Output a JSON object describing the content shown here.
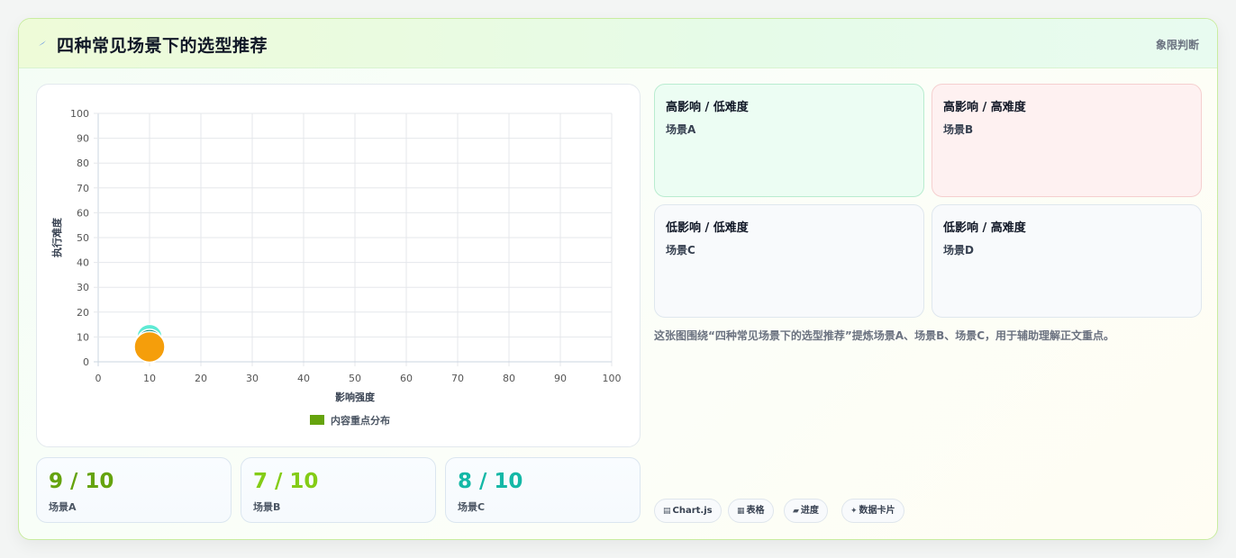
{
  "header": {
    "title": "四种常见场景下的选型推荐",
    "tag": "象限判断"
  },
  "chart_data": {
    "type": "scatter",
    "x_axis": {
      "label": "影响强度",
      "min": 0,
      "max": 100,
      "ticks": [
        0,
        10,
        20,
        30,
        40,
        50,
        60,
        70,
        80,
        90,
        100
      ]
    },
    "y_axis": {
      "label": "执行难度",
      "min": 0,
      "max": 100,
      "ticks": [
        0,
        10,
        20,
        30,
        40,
        50,
        60,
        70,
        80,
        90,
        100
      ]
    },
    "grid": true,
    "legend": {
      "position": "bottom",
      "label": "内容重点分布",
      "color": "#65a30d"
    },
    "points": [
      {
        "x": 10,
        "y": 10,
        "color": "#5eead4",
        "size": "medium"
      },
      {
        "x": 10,
        "y": 8,
        "color": "#0d9488",
        "size": "medium"
      },
      {
        "x": 10,
        "y": 6,
        "color": "#f59e0b",
        "size": "large"
      }
    ]
  },
  "stats": [
    {
      "value": "9 / 10",
      "label": "场景A",
      "color": "#65a30d"
    },
    {
      "value": "7 / 10",
      "label": "场景B",
      "color": "#84cc16"
    },
    {
      "value": "8 / 10",
      "label": "场景C",
      "color": "#14b8a6"
    }
  ],
  "quadrants": [
    {
      "title": "高影响 / 低难度",
      "item": "场景A",
      "tone": "green"
    },
    {
      "title": "高影响 / 高难度",
      "item": "场景B",
      "tone": "red"
    },
    {
      "title": "低影响 / 低难度",
      "item": "场景C",
      "tone": "neutral"
    },
    {
      "title": "低影响 / 高难度",
      "item": "场景D",
      "tone": "neutral"
    }
  ],
  "description": "这张图围绕“四种常见场景下的选型推荐”提炼场景A、场景B、场景C，用于辅助理解正文重点。",
  "chips": [
    {
      "icon": "chart-icon",
      "glyph": "▤",
      "label": "Chart.js"
    },
    {
      "icon": "table-icon",
      "glyph": "▦",
      "label": "表格"
    },
    {
      "icon": "progress-icon",
      "glyph": "▰",
      "label": "进度"
    },
    {
      "icon": "sparkle-icon",
      "glyph": "✦",
      "label": "数据卡片"
    }
  ]
}
